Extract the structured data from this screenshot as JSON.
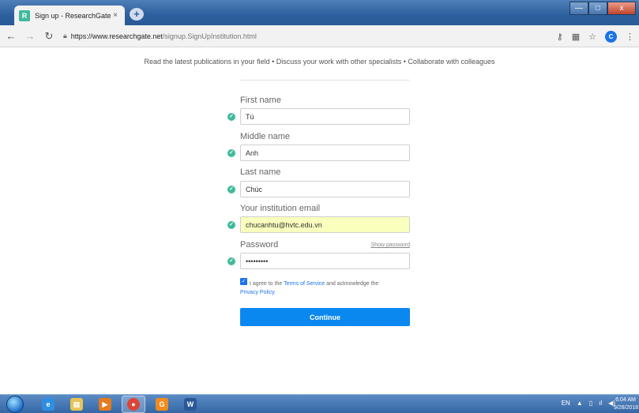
{
  "browser": {
    "tab_title": "Sign up - ResearchGate",
    "tab_close": "×",
    "new_tab": "+",
    "favicon_letter": "R",
    "url_host": "https://www.researchgate.net",
    "url_path": "/signup.SignUpInstitution.html",
    "profile_letter": "C",
    "window_buttons": {
      "minimize": "—",
      "maximize": "□",
      "close": "x"
    }
  },
  "page": {
    "tagline": "Read the latest publications in your field • Discuss your work with other specialists • Collaborate with colleagues"
  },
  "form": {
    "first_name": {
      "label": "First name",
      "value": "Tú"
    },
    "middle_name": {
      "label": "Middle name",
      "value": "Anh"
    },
    "last_name": {
      "label": "Last name",
      "value": "Chúc"
    },
    "email": {
      "label": "Your institution email",
      "value": "chucanhtu@hvtc.edu.vn"
    },
    "password": {
      "label": "Password",
      "value": "•••••••••",
      "show_label": "Show password"
    },
    "agree": {
      "checked": true,
      "text_before": "I agree to the ",
      "terms_link": "Terms of Service",
      "text_after": " and acknowledge the",
      "privacy_link": "Privacy Policy."
    },
    "continue_label": "Continue"
  },
  "taskbar": {
    "apps": [
      "ie-icon",
      "explorer-icon",
      "media-player-icon",
      "chrome-icon",
      "uc-browser-icon",
      "word-icon"
    ],
    "language": "EN",
    "clock_time": "6:04 AM",
    "clock_date": "9/28/2018"
  },
  "colors": {
    "accent": "#0b87f0",
    "check": "#40ba9b",
    "autofill": "#faffbd"
  }
}
